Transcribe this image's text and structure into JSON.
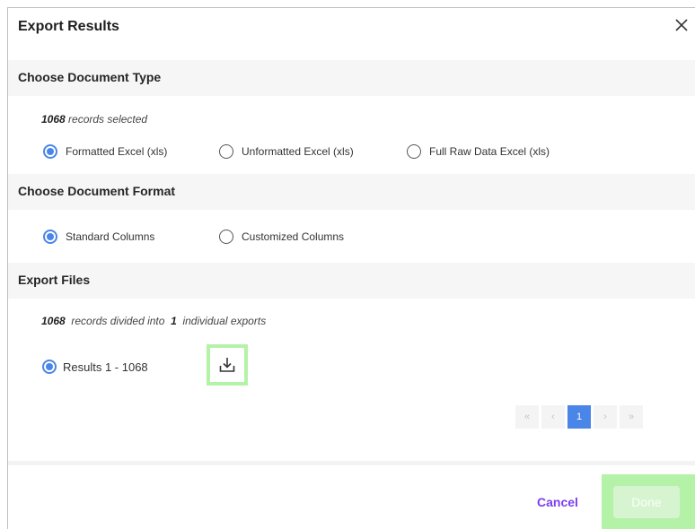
{
  "dialog": {
    "title": "Export Results"
  },
  "document_type": {
    "heading": "Choose Document Type",
    "record_count": "1068",
    "records_selected_text": "records selected",
    "options": [
      {
        "label": "Formatted Excel (xls)",
        "checked": true
      },
      {
        "label": "Unformatted Excel (xls)",
        "checked": false
      },
      {
        "label": "Full Raw Data Excel (xls)",
        "checked": false
      }
    ]
  },
  "document_format": {
    "heading": "Choose Document Format",
    "options": [
      {
        "label": "Standard Columns",
        "checked": true
      },
      {
        "label": "Customized Columns",
        "checked": false
      }
    ]
  },
  "export_files": {
    "heading": "Export Files",
    "record_count": "1068",
    "divided_text": "records divided into",
    "export_count": "1",
    "individual_exports_text": "individual exports",
    "result_label": "Results 1 - 1068",
    "download_icon": "download-icon"
  },
  "pagination": {
    "first": "«",
    "prev": "‹",
    "current": "1",
    "next": "›",
    "last": "»"
  },
  "footer": {
    "cancel_label": "Cancel",
    "done_label": "Done"
  },
  "colors": {
    "accent_blue": "#4a86e8",
    "cancel_purple": "#7b3ff0",
    "highlight_green": "#b4f2a8",
    "done_disabled": "#d7f4d1"
  }
}
